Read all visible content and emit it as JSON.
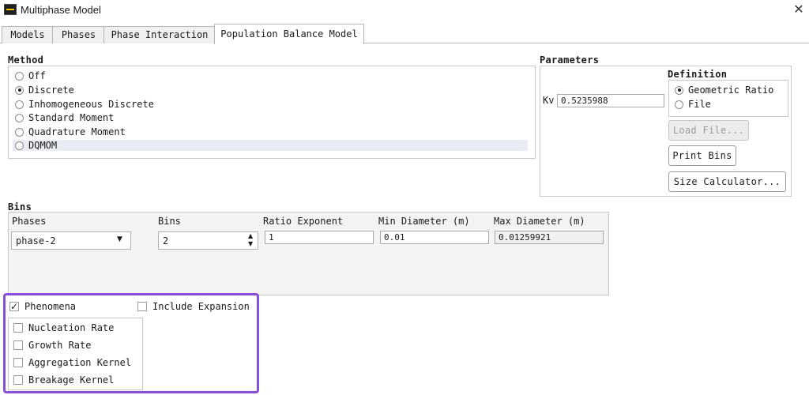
{
  "window": {
    "title": "Multiphase Model",
    "close_icon": "close-icon"
  },
  "tabs": [
    {
      "label": "Models"
    },
    {
      "label": "Phases"
    },
    {
      "label": "Phase Interaction"
    },
    {
      "label": "Population Balance Model",
      "active": true
    }
  ],
  "method": {
    "title": "Method",
    "options": [
      {
        "label": "Off",
        "checked": false
      },
      {
        "label": "Discrete",
        "checked": true
      },
      {
        "label": "Inhomogeneous Discrete",
        "checked": false
      },
      {
        "label": "Standard Moment",
        "checked": false
      },
      {
        "label": "Quadrature Moment",
        "checked": false
      },
      {
        "label": "DQMOM",
        "checked": false
      }
    ]
  },
  "parameters": {
    "title": "Parameters",
    "kv_label": "Kv",
    "kv_value": "0.5235988",
    "definition": {
      "title": "Definition",
      "options": [
        {
          "label": "Geometric Ratio",
          "checked": true
        },
        {
          "label": "File",
          "checked": false
        }
      ]
    },
    "buttons": {
      "load_file": "Load File...",
      "print_bins": "Print Bins",
      "size_calculator": "Size Calculator..."
    }
  },
  "bins": {
    "title": "Bins",
    "columns": {
      "phases": "Phases",
      "bins": "Bins",
      "ratio_exponent": "Ratio Exponent",
      "min_diameter": "Min Diameter (m)",
      "max_diameter": "Max Diameter (m)"
    },
    "values": {
      "phase": "phase-2",
      "bins": "2",
      "ratio_exponent": "1",
      "min_diameter": "0.01",
      "max_diameter": "0.01259921"
    }
  },
  "phenomena": {
    "label": "Phenomena",
    "checked": true,
    "include_expansion_label": "Include Expansion",
    "include_expansion_checked": false,
    "items": [
      {
        "label": "Nucleation Rate",
        "checked": false
      },
      {
        "label": "Growth Rate",
        "checked": false
      },
      {
        "label": "Aggregation Kernel",
        "checked": false
      },
      {
        "label": "Breakage Kernel",
        "checked": false
      }
    ],
    "highlight_color": "#8a4fd8"
  }
}
